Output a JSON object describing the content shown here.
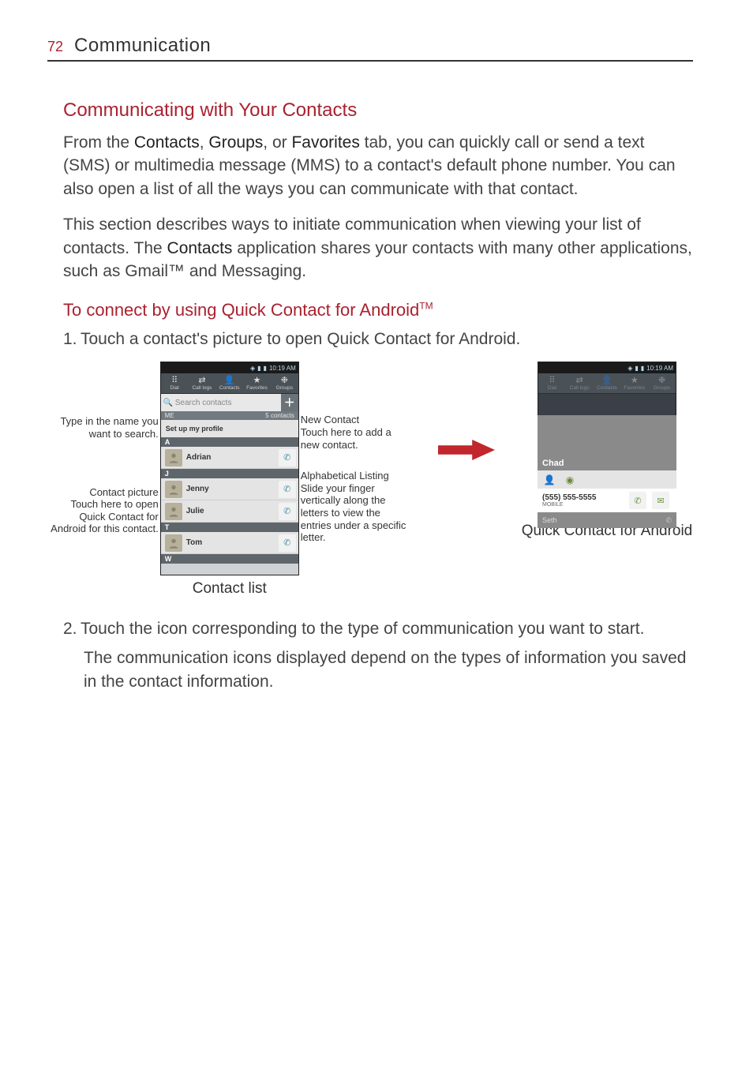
{
  "header": {
    "page_number": "72",
    "title": "Communication"
  },
  "section1": {
    "heading": "Communicating with Your Contacts",
    "para1_pre": "From the ",
    "para1_b1": "Contacts",
    "para1_mid1": ", ",
    "para1_b2": "Groups",
    "para1_mid2": ", or ",
    "para1_b3": "Favorites",
    "para1_post": " tab, you can quickly call or send a text (SMS) or multimedia message (MMS) to a contact's default phone number. You can also open a list of all the ways you can communicate with that contact.",
    "para2_pre": "This section describes ways to initiate communication when viewing your list of contacts. The ",
    "para2_b1": "Contacts",
    "para2_post": " application shares your contacts with many other applications, such as Gmail™ and Messaging."
  },
  "section2": {
    "heading_pre": "To connect by using Quick Contact for Android",
    "heading_tm": "TM",
    "step1": "Touch a contact's picture to open Quick Contact for Android.",
    "step2": "Touch the icon corresponding to the type of communication you want to start.",
    "step2_note": "The communication icons displayed depend on the types of information you saved in the contact information."
  },
  "annot": {
    "search_label": "Type in the name you want to search.",
    "picture_label": "Contact picture",
    "picture_desc": "Touch here to open Quick Contact for Android for this contact.",
    "newcontact_label": "New Contact",
    "newcontact_desc": "Touch here to add a new contact.",
    "alpha_label": "Alphabetical Listing",
    "alpha_desc": "Slide your finger vertically along the letters to view the entries under a specific letter.",
    "caption1": "Contact list",
    "caption2": "Quick Contact for Android"
  },
  "phone1": {
    "status_time": "10:19 AM",
    "tabs": [
      "Dial",
      "Call logs",
      "Contacts",
      "Favorites",
      "Groups"
    ],
    "search_placeholder": "Search contacts",
    "me_label": "ME",
    "count": "5 contacts",
    "profile": "Set up my profile",
    "letters": [
      "A",
      "J",
      "T",
      "W"
    ],
    "contacts": {
      "A": [
        "Adrian"
      ],
      "J": [
        "Jenny",
        "Julie"
      ],
      "T": [
        "Tom"
      ]
    }
  },
  "phone2": {
    "status_time": "10:19 AM",
    "tabs": [
      "Dial",
      "Call logs",
      "Contacts",
      "Favorites",
      "Groups"
    ],
    "qc_name": "Chad",
    "qc_number": "(555) 555-5555",
    "qc_type": "MOBILE",
    "qc_below": "Seth"
  }
}
